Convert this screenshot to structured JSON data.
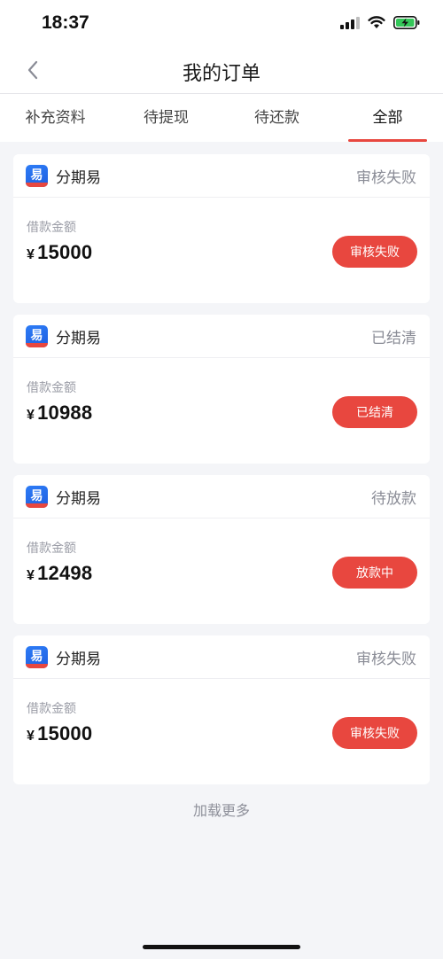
{
  "status_bar": {
    "time": "18:37"
  },
  "header": {
    "title": "我的订单"
  },
  "tabs": [
    {
      "label": "补充资料",
      "active": false
    },
    {
      "label": "待提现",
      "active": false
    },
    {
      "label": "待还款",
      "active": false
    },
    {
      "label": "全部",
      "active": true
    }
  ],
  "orders": [
    {
      "brand": "分期易",
      "status": "审核失败",
      "amount_label": "借款金额",
      "currency": "¥",
      "amount": "15000",
      "button": "审核失败"
    },
    {
      "brand": "分期易",
      "status": "已结清",
      "amount_label": "借款金额",
      "currency": "¥",
      "amount": "10988",
      "button": "已结清"
    },
    {
      "brand": "分期易",
      "status": "待放款",
      "amount_label": "借款金额",
      "currency": "¥",
      "amount": "12498",
      "button": "放款中"
    },
    {
      "brand": "分期易",
      "status": "审核失败",
      "amount_label": "借款金额",
      "currency": "¥",
      "amount": "15000",
      "button": "审核失败"
    }
  ],
  "footer": {
    "load_more": "加载更多"
  },
  "icons": {
    "back": "chevron-left-icon",
    "signal": "signal-icon",
    "wifi": "wifi-icon",
    "battery": "battery-charging-icon",
    "brand": "app-logo-icon"
  },
  "colors": {
    "accent": "#e8473f",
    "brand_blue": "#2d7cf6",
    "battery_green": "#34c759"
  }
}
